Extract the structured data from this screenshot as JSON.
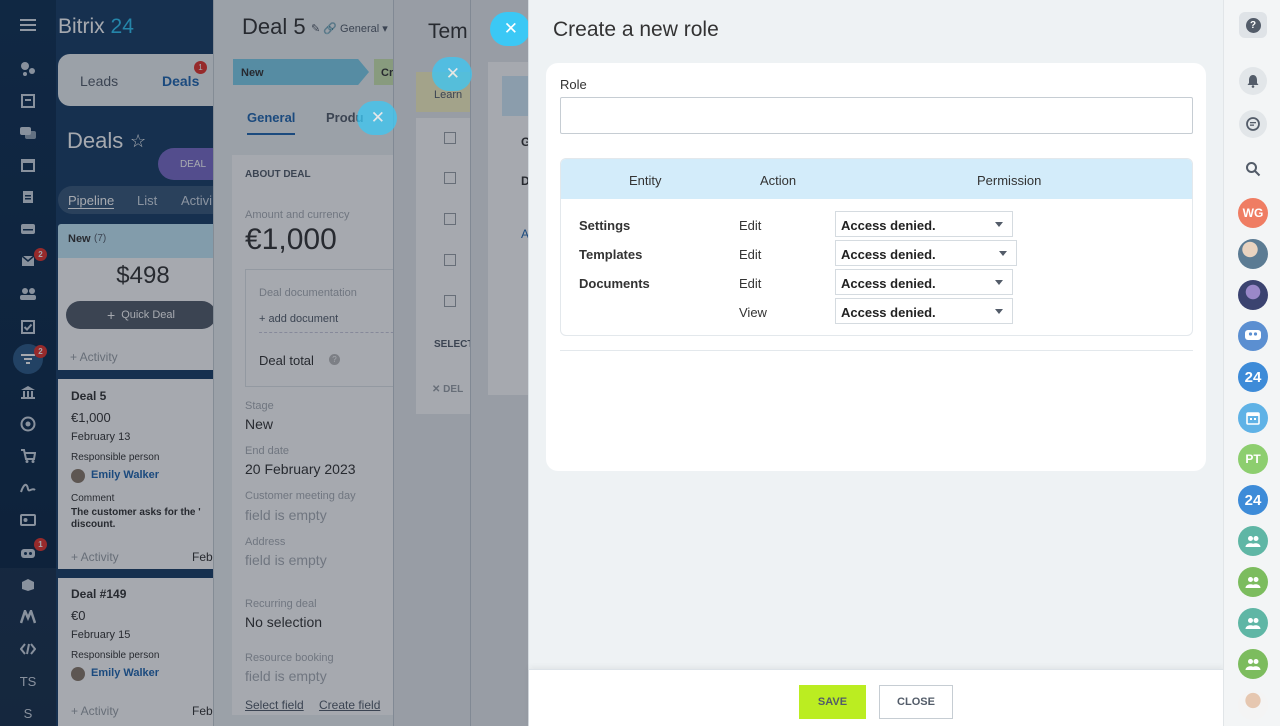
{
  "app": {
    "brand": "Bitrix",
    "brand_num": "24"
  },
  "leftnav": {
    "badges": {
      "mail": "2",
      "funnel": "2",
      "robot": "1"
    },
    "initials_ts": "TS",
    "initials_s": "S"
  },
  "crm": {
    "tab_leads": "Leads",
    "tab_deals": "Deals",
    "tab_deals_badge": "1",
    "title": "Deals",
    "chip": "DEAL",
    "views": [
      "Pipeline",
      "List",
      "Activi"
    ],
    "column": {
      "name": "New",
      "count": "(7)",
      "total": "$498",
      "quick_deal": "Quick Deal",
      "activity": "+ Activity"
    },
    "cards": [
      {
        "title": "Deal 5",
        "amount": "€1,000",
        "date": "February 13",
        "resp_label": "Responsible person",
        "person": "Emily Walker",
        "comment_label": "Comment",
        "comment": "The customer asks for the ' discount.",
        "activity": "+ Activity",
        "date_short": "Feb"
      },
      {
        "title": "Deal #149",
        "amount": "€0",
        "date": "February 15",
        "resp_label": "Responsible person",
        "person": "Emily Walker",
        "activity": "+ Activity",
        "date_short": "Feb"
      }
    ]
  },
  "deal": {
    "title": "Deal 5",
    "sub": "General",
    "stage_new": "New",
    "stage_next": "Cr",
    "tab_general": "General",
    "tab_products": "Produ",
    "about": "ABOUT DEAL",
    "amount_label": "Amount and currency",
    "amount": "€1,000",
    "doc_label": "Deal documentation",
    "add_doc": "+ add document",
    "total_label": "Deal total",
    "stage_label": "Stage",
    "stage_value": "New",
    "end_label": "End date",
    "end_value": "20 February 2023",
    "meeting_label": "Customer meeting day",
    "meeting_value": "field is empty",
    "address_label": "Address",
    "address_value": "field is empty",
    "recurring_label": "Recurring deal",
    "recurring_value": "No selection",
    "resource_label": "Resource booking",
    "resource_value": "field is empty",
    "select_field": "Select field",
    "create_field": "Create field"
  },
  "tmpl": {
    "title": "Tem",
    "learn": "Learn",
    "select": "SELECT",
    "delete": "DEL"
  },
  "third": {
    "g": "G",
    "d": "D",
    "a": "A"
  },
  "main": {
    "title": "Create a new role",
    "role_label": "Role",
    "role_value": "",
    "headers": {
      "entity": "Entity",
      "action": "Action",
      "permission": "Permission"
    },
    "rows": [
      {
        "entity": "Settings",
        "action": "Edit",
        "permission": "Access denied."
      },
      {
        "entity": "Templates",
        "action": "Edit",
        "permission": "Access denied."
      },
      {
        "entity": "Documents",
        "action": "Edit",
        "permission": "Access denied."
      },
      {
        "entity": "",
        "action": "View",
        "permission": "Access denied."
      }
    ],
    "save": "SAVE",
    "close": "CLOSE"
  },
  "rightbar": {
    "help": "?",
    "avatars": [
      "WG",
      "PT"
    ],
    "num": "24"
  },
  "colors": {
    "accent": "#2fc6f6",
    "save": "#bbed21",
    "badge": "#e6332a",
    "stage_new": "#7ed0ec"
  }
}
